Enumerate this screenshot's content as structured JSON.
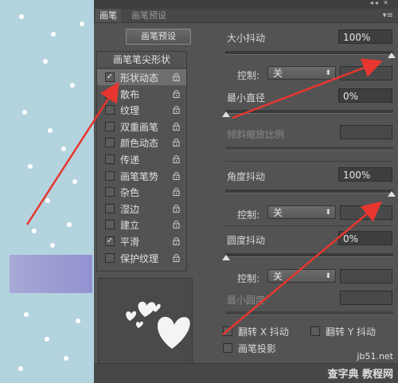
{
  "panel": {
    "tabs": [
      {
        "label": "画笔"
      },
      {
        "label": "画笔预设"
      }
    ],
    "preset_button": "画笔预设",
    "list_header": "画笔笔尖形状",
    "items": [
      {
        "label": "形状动态",
        "checked": true,
        "selected": true
      },
      {
        "label": "散布",
        "checked": false
      },
      {
        "label": "纹理",
        "checked": false
      },
      {
        "label": "双重画笔",
        "checked": false
      },
      {
        "label": "颜色动态",
        "checked": false
      },
      {
        "label": "传递",
        "checked": false
      },
      {
        "label": "画笔笔势",
        "checked": false
      },
      {
        "label": "杂色",
        "checked": false
      },
      {
        "label": "湿边",
        "checked": false
      },
      {
        "label": "建立",
        "checked": false
      },
      {
        "label": "平滑",
        "checked": true
      },
      {
        "label": "保护纹理",
        "checked": false
      }
    ]
  },
  "settings": {
    "size_jitter": {
      "label": "大小抖动",
      "value": "100%"
    },
    "size_control": {
      "label": "控制:",
      "value": "关"
    },
    "min_diameter": {
      "label": "最小直径",
      "value": "0%"
    },
    "tilt_scale": {
      "label": "倾斜缩放比例"
    },
    "angle_jitter": {
      "label": "角度抖动",
      "value": "100%"
    },
    "angle_control": {
      "label": "控制:",
      "value": "关"
    },
    "roundness_jitter": {
      "label": "圆度抖动",
      "value": "0%"
    },
    "roundness_control": {
      "label": "控制:",
      "value": "关"
    },
    "min_roundness": {
      "label": "最小圆度"
    },
    "flip_x": {
      "label": "翻转 X 抖动"
    },
    "flip_y": {
      "label": "翻转 Y 抖动"
    },
    "brush_projection": {
      "label": "画笔投影"
    }
  },
  "watermark": {
    "line1": "jb51.net",
    "line2": "查字典 教程网"
  },
  "colors": {
    "panel": "#535353",
    "arrow": "#e8362f",
    "canvas": "#b3d3de"
  }
}
